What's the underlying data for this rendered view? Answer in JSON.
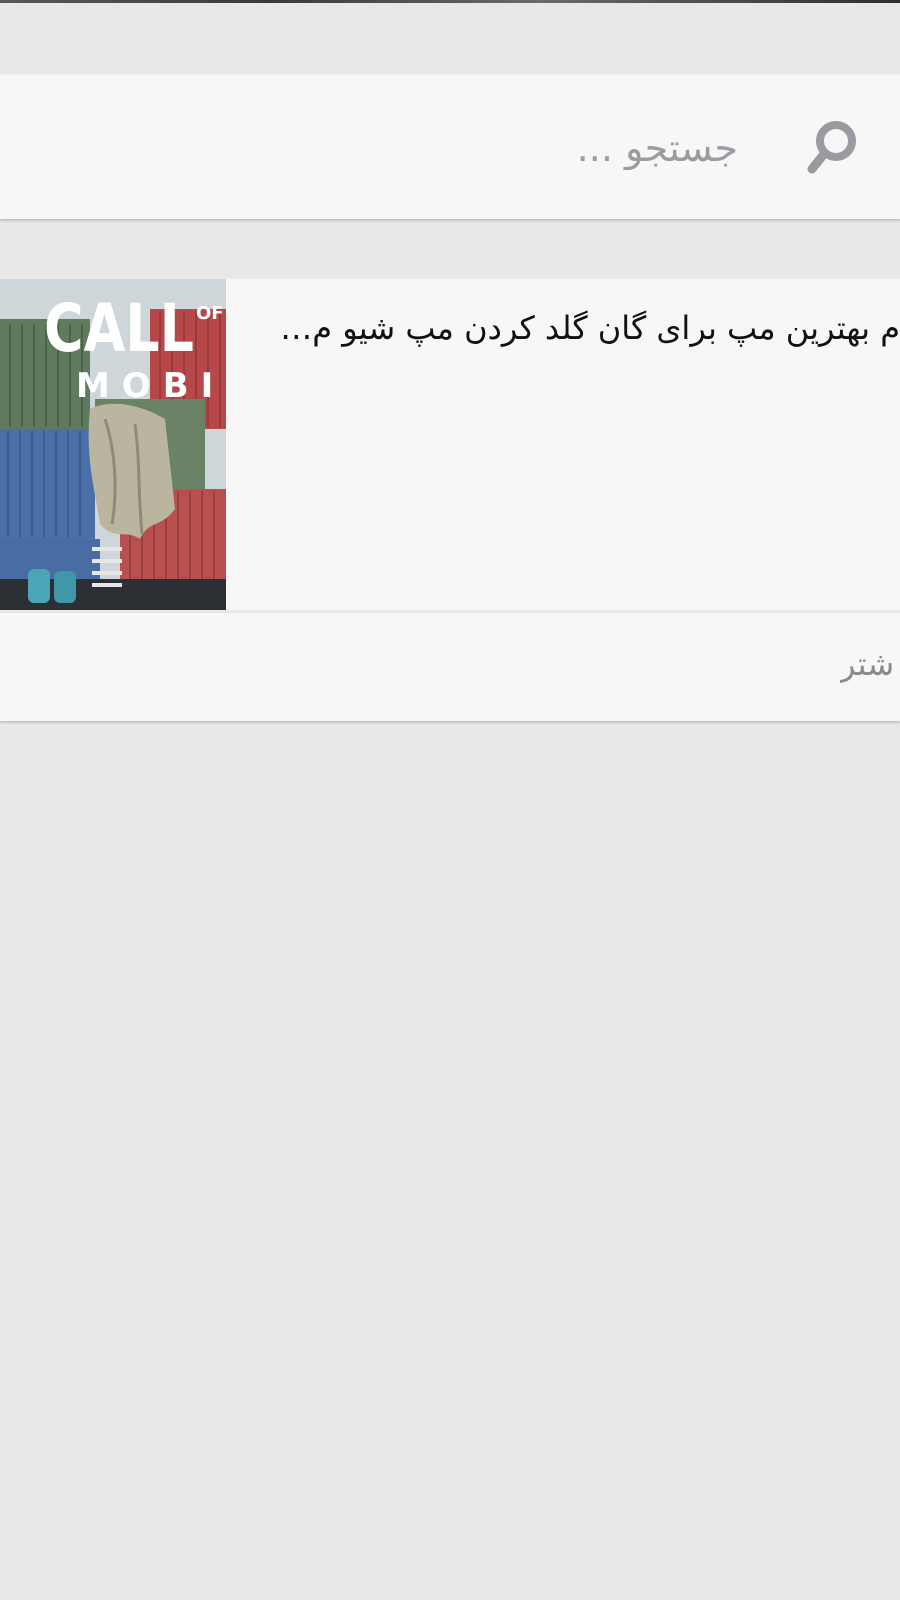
{
  "search": {
    "placeholder": "جستجو ..."
  },
  "results": [
    {
      "title": "م بهترین مپ برای گان گلد کردن مپ شیو م…",
      "thumbnail_text": {
        "line1": "CALL",
        "line1_small": "OF",
        "line2": "MOBI"
      }
    }
  ],
  "more": {
    "label": "شتر"
  },
  "colors": {
    "background": "#e8e8e9",
    "card": "#f7f7f7",
    "placeholder": "#9b9ba1",
    "title": "#111111",
    "icon": "#9a9aa0"
  }
}
